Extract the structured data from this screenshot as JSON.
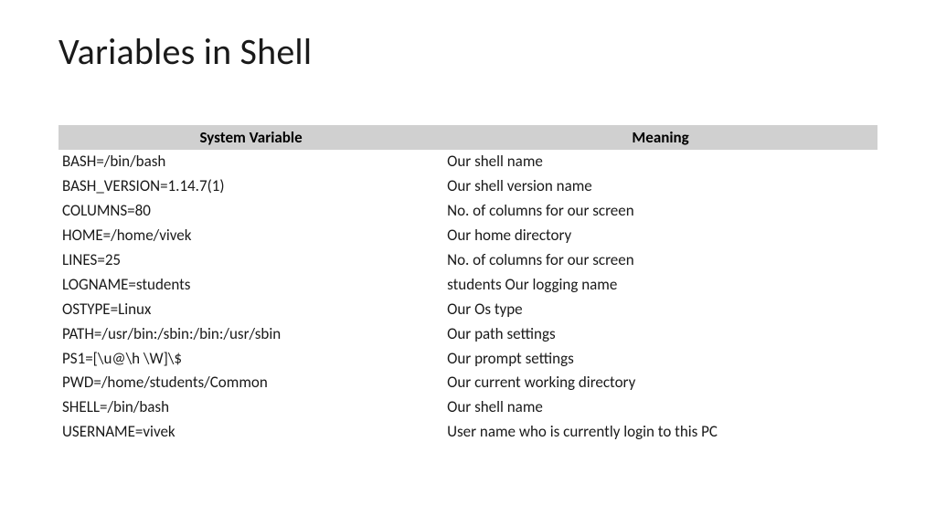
{
  "title": "Variables in Shell",
  "table": {
    "headers": {
      "col1": "System Variable",
      "col2": "Meaning"
    },
    "rows": [
      {
        "var": "BASH=/bin/bash",
        "meaning": "Our shell name"
      },
      {
        "var": "BASH_VERSION=1.14.7(1)",
        "meaning": "Our shell version name"
      },
      {
        "var": "COLUMNS=80",
        "meaning": "No. of columns for our screen"
      },
      {
        "var": "HOME=/home/vivek",
        "meaning": "Our home directory"
      },
      {
        "var": "LINES=25",
        "meaning": "No. of columns for our screen"
      },
      {
        "var": "LOGNAME=students",
        "meaning": "students Our logging name"
      },
      {
        "var": "OSTYPE=Linux",
        "meaning": "Our Os type"
      },
      {
        "var": "PATH=/usr/bin:/sbin:/bin:/usr/sbin",
        "meaning": "Our path settings"
      },
      {
        "var": "PS1=[\\u@\\h \\W]\\$",
        "meaning": "Our prompt settings"
      },
      {
        "var": "PWD=/home/students/Common",
        "meaning": "Our current working directory"
      },
      {
        "var": "SHELL=/bin/bash",
        "meaning": "Our shell name"
      },
      {
        "var": "USERNAME=vivek",
        "meaning": "User name who is currently login to this PC"
      }
    ]
  }
}
